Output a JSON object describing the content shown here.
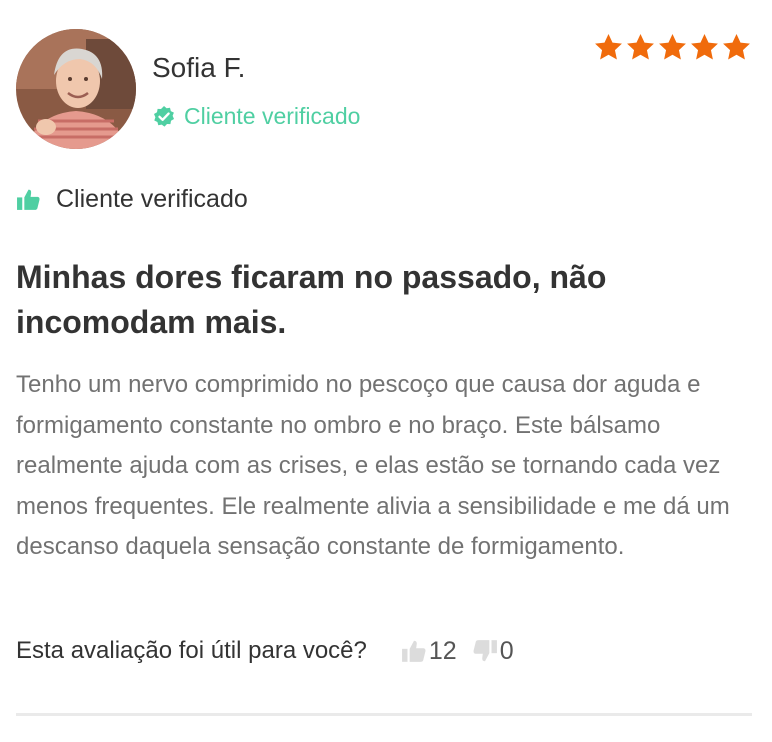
{
  "reviewer": {
    "name": "Sofia F.",
    "verified_label": "Cliente verificado",
    "verified_color": "#4fcfa2"
  },
  "rating": {
    "stars": 5,
    "max": 5,
    "color": "#f06b0c"
  },
  "recommend": {
    "label": "Cliente verificado",
    "icon": "thumbs-up-icon"
  },
  "review": {
    "title": "Minhas dores ficaram no passado, não incomodam mais.",
    "body": "Tenho um nervo comprimido no pescoço que causa dor aguda e formigamento constante no ombro e no braço. Este bálsamo realmente ajuda com as crises, e elas estão se tornando cada vez menos frequentes. Ele realmente alivia a sensibilidade e me dá um descanso daquela sensação constante de formigamento."
  },
  "helpful": {
    "question": "Esta avaliação foi útil para você?",
    "up_count": "12",
    "down_count": "0"
  }
}
